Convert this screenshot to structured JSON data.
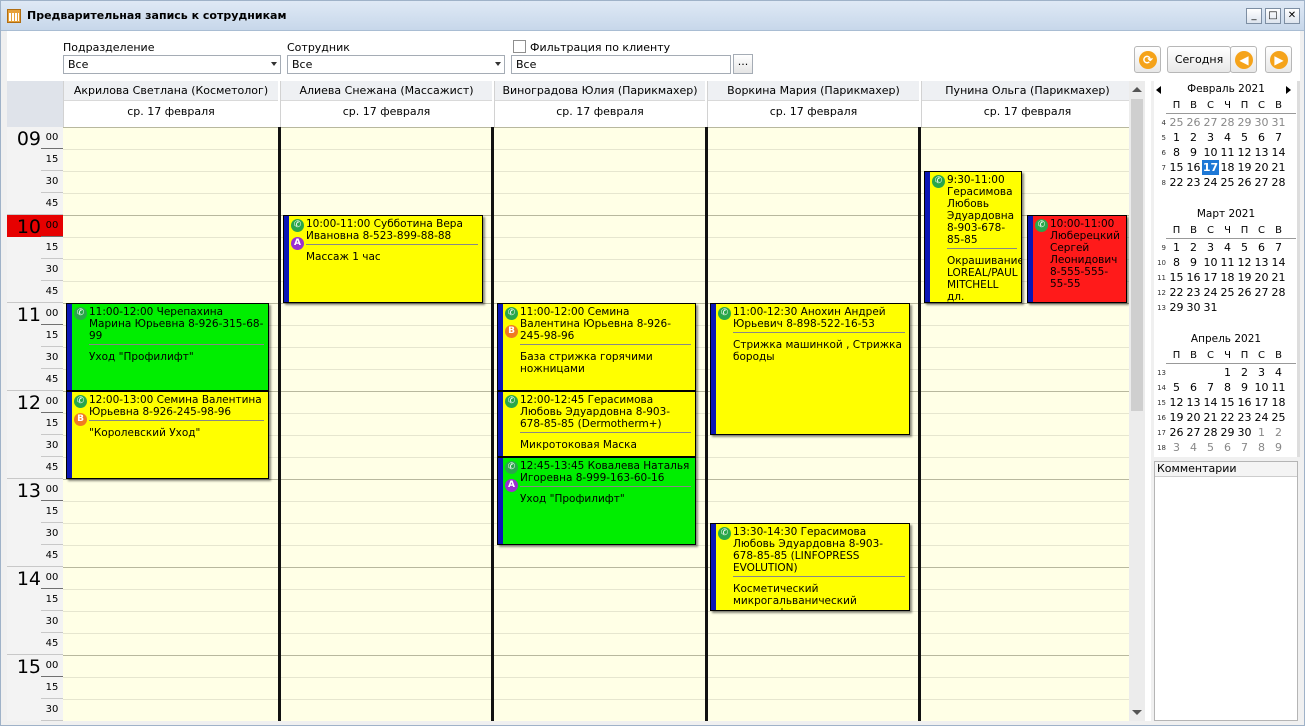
{
  "window": {
    "title": "Предварительная запись к сотрудникам",
    "controls": {
      "min": "_",
      "max": "□",
      "close": "✕"
    }
  },
  "filters": {
    "department": {
      "label": "Подразделение",
      "value": "Все"
    },
    "employee": {
      "label": "Сотрудник",
      "value": "Все"
    },
    "client_filter": {
      "label": "Фильтрация по клиенту",
      "checked": false,
      "value": "Все",
      "browse": "..."
    }
  },
  "toolbar": {
    "today_label": "Сегодня",
    "refresh_icon": "refresh-icon",
    "prev_icon": "arrow-left-icon",
    "next_icon": "arrow-right-icon",
    "accent": "#f5a31a"
  },
  "timeline": {
    "hours": [
      "09",
      "10",
      "11",
      "12",
      "13",
      "14",
      "15"
    ],
    "minutes": [
      "00",
      "15",
      "30",
      "45"
    ],
    "current_hour": "10",
    "current_hour_color": "#e60000"
  },
  "columns": [
    {
      "name": "Акрилова Светлана (Косметолог)",
      "date": "ср. 17 февраля"
    },
    {
      "name": "Алиева Снежана (Массажист)",
      "date": "ср. 17 февраля"
    },
    {
      "name": "Виноградова Юлия (Парикмахер)",
      "date": "ср. 17 февраля"
    },
    {
      "name": "Воркина Мария (Парикмахер)",
      "date": "ср. 17 февраля"
    },
    {
      "name": "Пунина Ольга (Парикмахер)",
      "date": "ср. 17 февраля"
    }
  ],
  "appointments": [
    {
      "col": 0,
      "start": "11:00",
      "end": "12:00",
      "color": "green",
      "header": "11:00-12:00 Черепахина Марина Юрьевна 8-926-315-68-99",
      "service": "Уход \"Профилифт\"",
      "badge": "",
      "badge_color": ""
    },
    {
      "col": 0,
      "start": "12:00",
      "end": "13:00",
      "color": "yellow",
      "header": "12:00-13:00 Семина Валентина Юрьевна 8-926-245-98-96",
      "service": "\"Королевский Уход\"",
      "badge": "В",
      "badge_color": "#f07c22"
    },
    {
      "col": 1,
      "start": "10:00",
      "end": "11:00",
      "color": "yellow",
      "header": "10:00-11:00 Субботина Вера Ивановна 8-523-899-88-88",
      "service": "Массаж 1 час",
      "badge": "А",
      "badge_color": "#9b2fd0"
    },
    {
      "col": 2,
      "start": "11:00",
      "end": "12:00",
      "color": "yellow",
      "header": "11:00-12:00 Семина Валентина Юрьевна 8-926-245-98-96",
      "service": "База стрижка горячими ножницами",
      "badge": "В",
      "badge_color": "#f07c22"
    },
    {
      "col": 2,
      "start": "12:00",
      "end": "12:45",
      "color": "yellow",
      "header": "12:00-12:45 Герасимова Любовь Эдуардовна 8-903-678-85-85 (Dermotherm+)",
      "service": "Микротоковая Маска",
      "badge": "",
      "badge_color": ""
    },
    {
      "col": 2,
      "start": "12:45",
      "end": "13:45",
      "color": "green",
      "header": "12:45-13:45 Ковалева Наталья Игоревна 8-999-163-60-16",
      "service": "Уход \"Профилифт\"",
      "badge": "А",
      "badge_color": "#9b2fd0"
    },
    {
      "col": 3,
      "start": "11:00",
      "end": "12:30",
      "color": "yellow",
      "header": "11:00-12:30 Анохин Андрей Юрьевич 8-898-522-16-53",
      "service": "Стрижка машинкой , Стрижка бороды",
      "badge": "",
      "badge_color": ""
    },
    {
      "col": 3,
      "start": "13:30",
      "end": "14:30",
      "color": "yellow",
      "header": "13:30-14:30 Герасимова Любовь Эдуардовна 8-903-678-85-85 (LINFOPRESS EVOLUTION)",
      "service": "Косметический микрогальванический электрофорез",
      "badge": "",
      "badge_color": ""
    },
    {
      "col": 4,
      "start": "9:30",
      "end": "11:00",
      "color": "yellow",
      "header": "9:30-11:00 Герасимова Любовь Эдуардовна 8-903-678-85-85",
      "service": "Окрашивание LOREAL/PAUL MITCHELL дл.",
      "badge": "",
      "badge_color": "",
      "sub": 0
    },
    {
      "col": 4,
      "start": "10:00",
      "end": "11:00",
      "color": "red",
      "header": "10:00-11:00 Люберецкий Сергей Леонидович 8-555-555-55-55",
      "service": "",
      "badge": "",
      "badge_color": "",
      "sub": 1
    }
  ],
  "calendar": {
    "weekdays": [
      "П",
      "В",
      "С",
      "Ч",
      "П",
      "С",
      "В"
    ],
    "months": [
      {
        "title": "Февраль 2021",
        "weeks": [
          "4",
          "5",
          "6",
          "7",
          "8"
        ],
        "days": [
          [
            "25",
            "26",
            "27",
            "28",
            "29",
            "30",
            "31"
          ],
          [
            "1",
            "2",
            "3",
            "4",
            "5",
            "6",
            "7"
          ],
          [
            "8",
            "9",
            "10",
            "11",
            "12",
            "13",
            "14"
          ],
          [
            "15",
            "16",
            "17",
            "18",
            "19",
            "20",
            "21"
          ],
          [
            "22",
            "23",
            "24",
            "25",
            "26",
            "27",
            "28"
          ]
        ],
        "other_first_row": true,
        "selected": "17"
      },
      {
        "title": "Март 2021",
        "weeks": [
          "9",
          "10",
          "11",
          "12",
          "13"
        ],
        "days": [
          [
            "1",
            "2",
            "3",
            "4",
            "5",
            "6",
            "7"
          ],
          [
            "8",
            "9",
            "10",
            "11",
            "12",
            "13",
            "14"
          ],
          [
            "15",
            "16",
            "17",
            "18",
            "19",
            "20",
            "21"
          ],
          [
            "22",
            "23",
            "24",
            "25",
            "26",
            "27",
            "28"
          ],
          [
            "29",
            "30",
            "31",
            "",
            "",
            "",
            ""
          ]
        ]
      },
      {
        "title": "Апрель 2021",
        "weeks": [
          "13",
          "14",
          "15",
          "16",
          "17",
          "18"
        ],
        "days": [
          [
            "",
            "",
            "",
            "1",
            "2",
            "3",
            "4"
          ],
          [
            "5",
            "6",
            "7",
            "8",
            "9",
            "10",
            "11"
          ],
          [
            "12",
            "13",
            "14",
            "15",
            "16",
            "17",
            "18"
          ],
          [
            "19",
            "20",
            "21",
            "22",
            "23",
            "24",
            "25"
          ],
          [
            "26",
            "27",
            "28",
            "29",
            "30",
            "1",
            "2"
          ],
          [
            "3",
            "4",
            "5",
            "6",
            "7",
            "8",
            "9"
          ]
        ]
      }
    ]
  },
  "comments": {
    "label": "Комментарии"
  }
}
